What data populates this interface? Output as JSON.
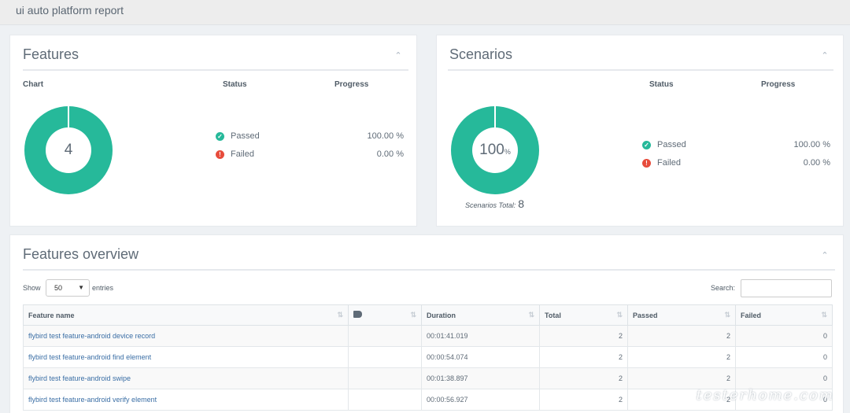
{
  "app": {
    "title": "ui auto platform report"
  },
  "features": {
    "title": "Features",
    "headers": {
      "chart": "Chart",
      "status": "Status",
      "progress": "Progress"
    },
    "donut_value": "4",
    "rows": [
      {
        "label": "Passed",
        "value": "100.00 %"
      },
      {
        "label": "Failed",
        "value": "0.00 %"
      }
    ]
  },
  "scenarios": {
    "title": "Scenarios",
    "headers": {
      "status": "Status",
      "progress": "Progress"
    },
    "donut_value": "100",
    "donut_unit": "%",
    "total_label": "Scenarios Total:",
    "total_value": "8",
    "rows": [
      {
        "label": "Passed",
        "value": "100.00 %"
      },
      {
        "label": "Failed",
        "value": "0.00 %"
      }
    ]
  },
  "overview": {
    "title": "Features overview",
    "show_label": "Show",
    "entries_value": "50",
    "entries_label": "entries",
    "search_label": "Search:",
    "search_value": "",
    "columns": [
      "Feature name",
      "",
      "Duration",
      "Total",
      "Passed",
      "Failed"
    ],
    "rows": [
      {
        "name": "flybird test feature-android device record",
        "tags": "",
        "duration": "00:01:41.019",
        "total": "2",
        "passed": "2",
        "failed": "0"
      },
      {
        "name": "flybird test feature-android find element",
        "tags": "",
        "duration": "00:00:54.074",
        "total": "2",
        "passed": "2",
        "failed": "0"
      },
      {
        "name": "flybird test feature-android swipe",
        "tags": "",
        "duration": "00:01:38.897",
        "total": "2",
        "passed": "2",
        "failed": "0"
      },
      {
        "name": "flybird test feature-android verify element",
        "tags": "",
        "duration": "00:00:56.927",
        "total": "2",
        "passed": "2",
        "failed": "0"
      }
    ]
  },
  "watermark": "testerhome.com",
  "colors": {
    "passed": "#26b99a",
    "failed": "#e74c3c",
    "link": "#3a6ea5"
  }
}
